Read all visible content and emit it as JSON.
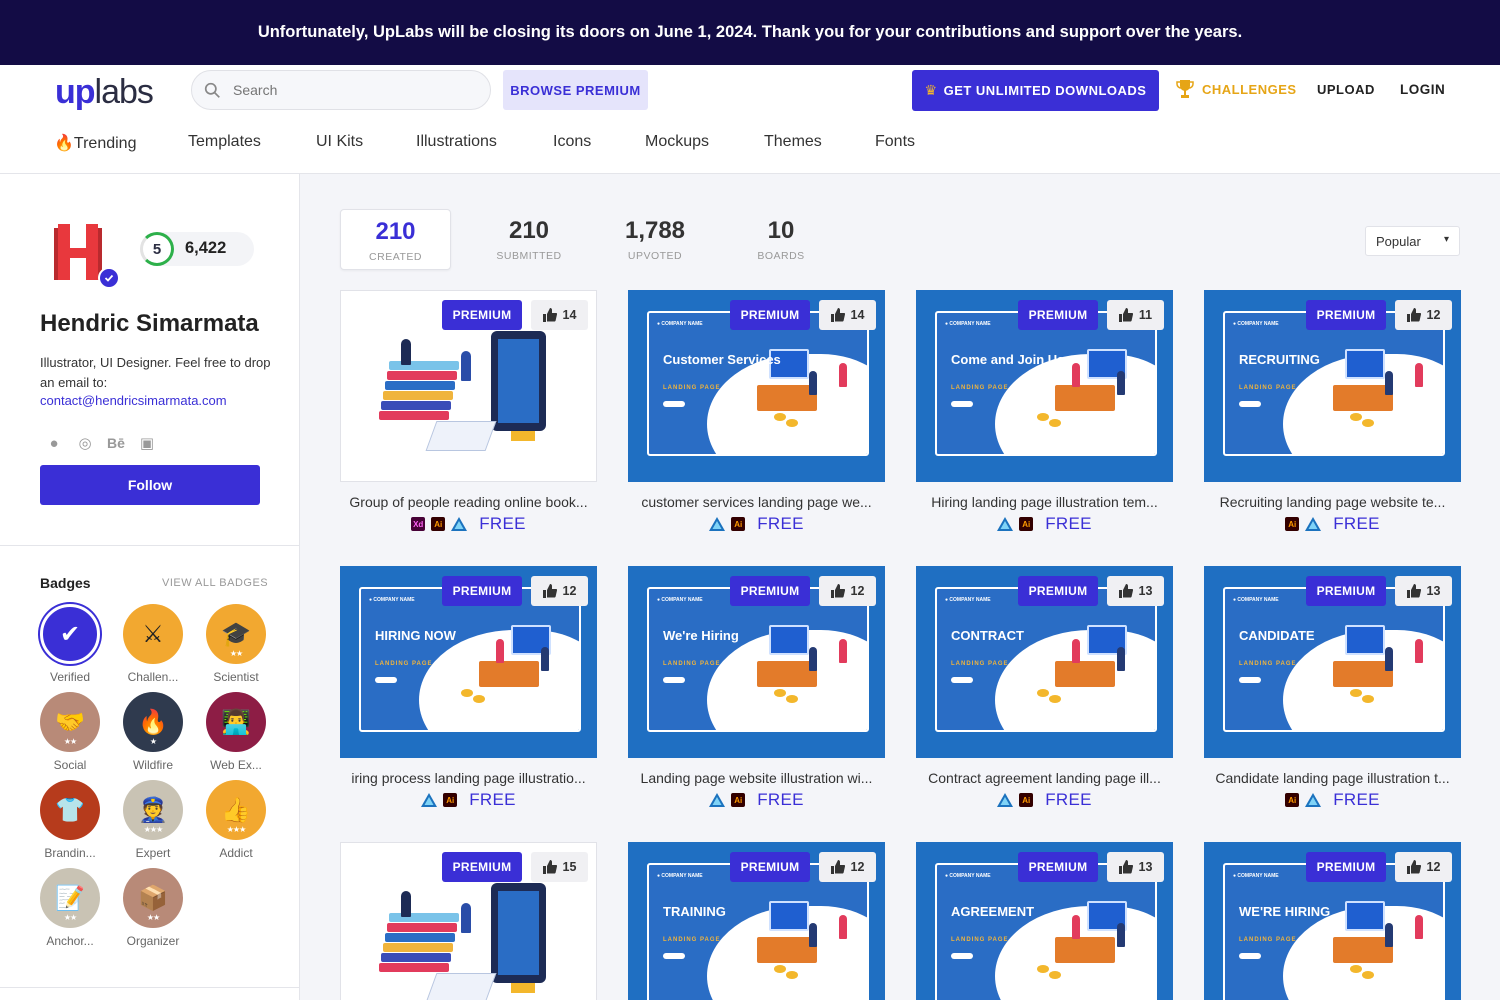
{
  "banner": {
    "text": "Unfortunately, UpLabs will be closing its doors on June 1, 2024. Thank you for your contributions and support over the years."
  },
  "header": {
    "logo_up": "up",
    "logo_labs": "labs",
    "search_placeholder": "Search",
    "browse_premium": "BROWSE PREMIUM",
    "unlimited": "GET UNLIMITED DOWNLOADS",
    "challenges": "CHALLENGES",
    "upload": "UPLOAD",
    "login": "LOGIN"
  },
  "nav": [
    "Trending",
    "Templates",
    "UI Kits",
    "Illustrations",
    "Icons",
    "Mockups",
    "Themes",
    "Fonts"
  ],
  "profile": {
    "level": "5",
    "points": "6,422",
    "name": "Hendric Simarmata",
    "bio": "Illustrator, UI Designer. Feel free to drop an email to:",
    "email": "contact@hendricsimarmata.com",
    "follow": "Follow",
    "avatar_letter": "H"
  },
  "badges": {
    "title": "Badges",
    "view_all": "VIEW ALL BADGES",
    "items": [
      {
        "label": "Verified",
        "icon": "check-icon",
        "color": "#3a2fd6"
      },
      {
        "label": "Challen...",
        "icon": "swords-icon",
        "color": "#f2a830"
      },
      {
        "label": "Scientist",
        "icon": "graduation-cap-icon",
        "color": "#f2a830"
      },
      {
        "label": "Social",
        "icon": "handshake-icon",
        "color": "#b88a78"
      },
      {
        "label": "Wildfire",
        "icon": "fire-icon",
        "color": "#2f3a4e"
      },
      {
        "label": "Web Ex...",
        "icon": "developer-icon",
        "color": "#8d1d45"
      },
      {
        "label": "Brandin...",
        "icon": "tshirt-icon",
        "color": "#b63b1c"
      },
      {
        "label": "Expert",
        "icon": "expert-icon",
        "color": "#c9c3b4"
      },
      {
        "label": "Addict",
        "icon": "thumbs-up-icon",
        "color": "#f2a830"
      },
      {
        "label": "Anchor...",
        "icon": "notepad-icon",
        "color": "#c9c3b4"
      },
      {
        "label": "Organizer",
        "icon": "box-icon",
        "color": "#b88a78"
      }
    ]
  },
  "stats": [
    {
      "num": "210",
      "cap": "CREATED"
    },
    {
      "num": "210",
      "cap": "SUBMITTED"
    },
    {
      "num": "1,788",
      "cap": "UPVOTED"
    },
    {
      "num": "10",
      "cap": "BOARDS"
    }
  ],
  "sort": "Popular",
  "premium_label": "PREMIUM",
  "free_label": "FREE",
  "cards": [
    {
      "title": "Group of people reading online book...",
      "likes": "14",
      "style": "white",
      "heading": "",
      "tools": [
        "xd",
        "ai",
        "af"
      ]
    },
    {
      "title": "customer services landing page we...",
      "likes": "14",
      "style": "blue",
      "heading": "Customer Services",
      "sub": "LANDING PAGE",
      "tools": [
        "af",
        "ai"
      ]
    },
    {
      "title": "Hiring landing page illustration tem...",
      "likes": "11",
      "style": "blue",
      "heading": "Come and Join Us",
      "sub": "LANDING PAGE",
      "tools": [
        "af",
        "ai"
      ]
    },
    {
      "title": "Recruiting landing page website te...",
      "likes": "12",
      "style": "blue",
      "heading": "RECRUITING",
      "sub": "LANDING PAGE",
      "tools": [
        "ai",
        "af"
      ]
    },
    {
      "title": "iring process landing page illustratio...",
      "likes": "12",
      "style": "blue",
      "heading": "HIRING NOW",
      "sub": "LANDING PAGE",
      "tools": [
        "af",
        "ai"
      ]
    },
    {
      "title": "Landing page website illustration wi...",
      "likes": "12",
      "style": "blue",
      "heading": "We're Hiring",
      "sub": "LANDING PAGE",
      "tools": [
        "af",
        "ai"
      ]
    },
    {
      "title": "Contract agreement landing page ill...",
      "likes": "13",
      "style": "blue",
      "heading": "CONTRACT",
      "sub": "LANDING PAGE",
      "tools": [
        "af",
        "ai"
      ]
    },
    {
      "title": "Candidate landing page illustration t...",
      "likes": "13",
      "style": "blue",
      "heading": "CANDIDATE",
      "sub": "LANDING PAGE",
      "tools": [
        "ai",
        "af"
      ]
    },
    {
      "title": "",
      "likes": "15",
      "style": "white",
      "heading": "",
      "tools": []
    },
    {
      "title": "",
      "likes": "12",
      "style": "blue",
      "heading": "TRAINING",
      "sub": "LANDING PAGE",
      "tools": []
    },
    {
      "title": "",
      "likes": "13",
      "style": "blue",
      "heading": "AGREEMENT",
      "sub": "LANDING PAGE",
      "tools": []
    },
    {
      "title": "",
      "likes": "12",
      "style": "blue",
      "heading": "WE'RE HIRING",
      "sub": "LANDING PAGE",
      "tools": []
    }
  ],
  "colors": {
    "accent": "#3a2fd6",
    "banner": "#130c45",
    "challenges": "#e6a516",
    "card_blue": "#1f6fc2"
  }
}
